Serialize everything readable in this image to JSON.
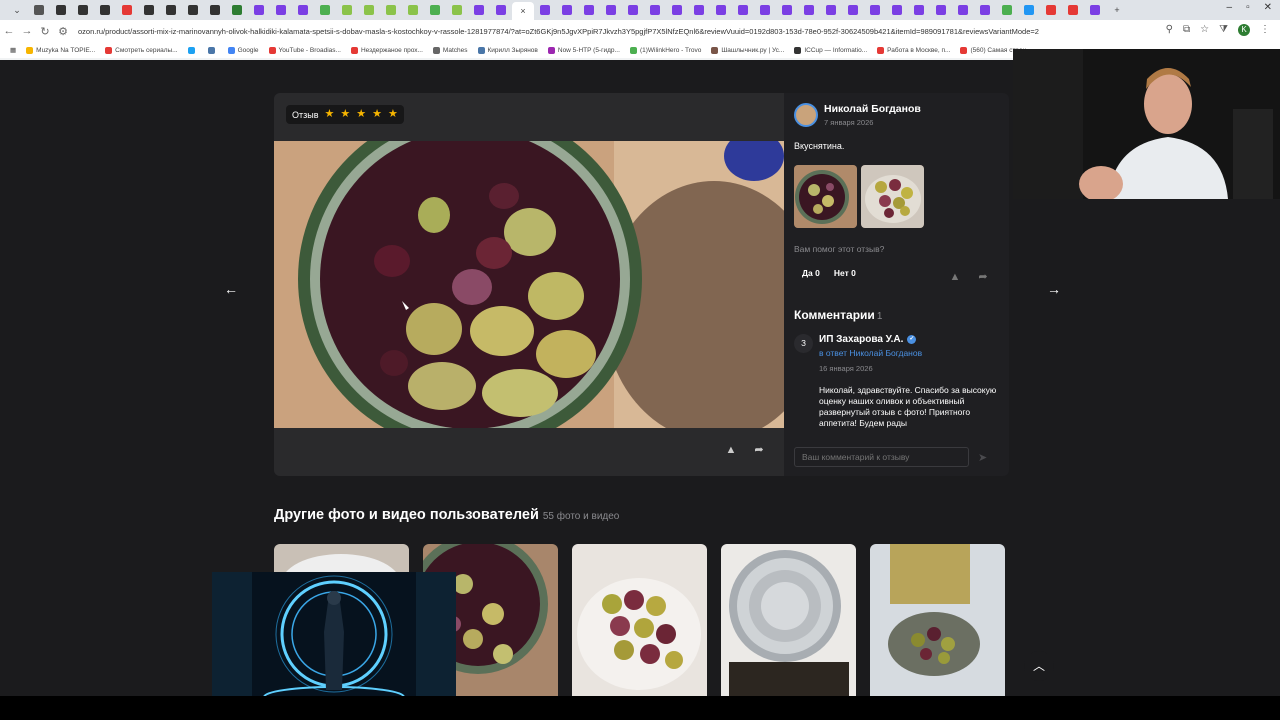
{
  "browser": {
    "url": "ozon.ru/product/assorti-mix-iz-marinovannyh-olivok-halkidiki-kalamata-spetsii-s-dobav-masla-s-kostochkoy-v-rassole-1281977874/?at=oZt6GKj9n5JgvXPpiR7Jkvzh3Y5pgjfP7X5lNfzEQnl6&reviewVuuid=0192d803-153d-78e0-952f-30624509b421&itemId=989091781&reviewsVariantMode=2",
    "profile_letter": "K",
    "bookmarks": [
      "Muzyka Na TOPIE...",
      "Смотреть сериалы...",
      "",
      "",
      "Google",
      "YouTube - Broadias...",
      "Нездержаное прох...",
      "Matches",
      "Кирилл Зырянов",
      "Now 5-HTP (5-гидр...",
      "(1)WilinkHero - Trovo",
      "Шашлычник.ру | Ус...",
      "ICCup — Informatio...",
      "Работа в Москве, п...",
      "(560) Самая стран..."
    ]
  },
  "review": {
    "badge_label": "Отзыв",
    "stars": 5,
    "author_name": "Николай Богданов",
    "date": "7 января 2026",
    "text": "Вкуснятина.",
    "helpful_question": "Вам помог этот отзыв?",
    "yes_label": "Да 0",
    "no_label": "Нет 0"
  },
  "comments": {
    "title": "Комментарии",
    "count": "1",
    "items": [
      {
        "avatar_letter": "З",
        "author": "ИП Захарова У.А.",
        "reply_to": "в ответ Николай Богданов",
        "date": "16 января 2026",
        "text": "Николай, здравствуйте. Спасибо за высокую оценку наших оливок и объективный развернутый отзыв с фото! Приятного аппетита! Будем рады"
      }
    ],
    "input_placeholder": "Ваш комментарий к отзыву"
  },
  "gallery": {
    "title": "Другие фото и видео пользователей",
    "count": "55 фото и видео"
  },
  "colors": {
    "page_bg": "#1b1b1d",
    "accent_blue": "#4a90e2",
    "star": "#f7b500"
  }
}
